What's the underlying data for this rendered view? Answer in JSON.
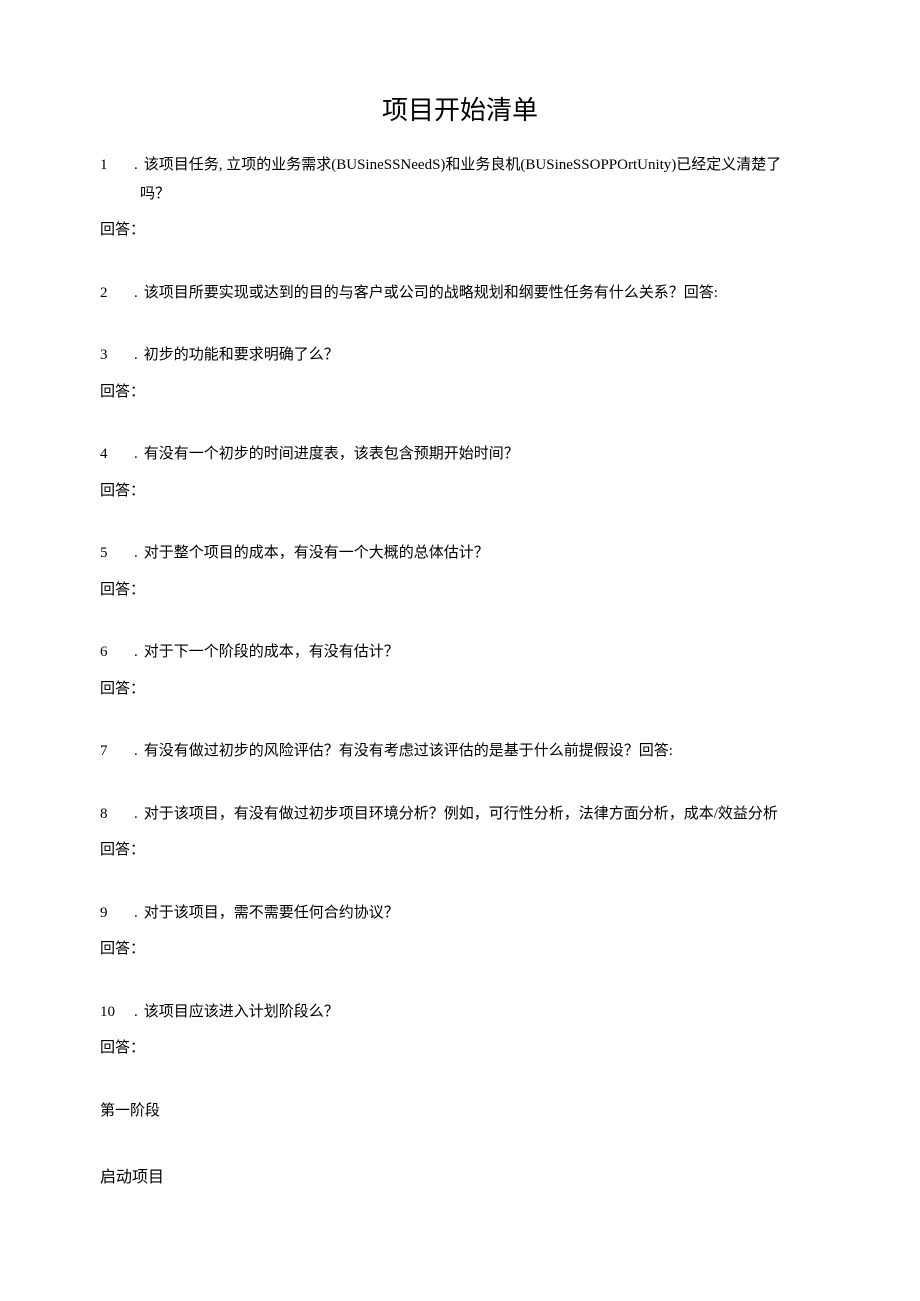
{
  "title": "项目开始清单",
  "answer_label": "回答：",
  "answer_label_alt": "回答:",
  "questions": [
    {
      "number": "1",
      "dot": ".",
      "text": "该项目任务, 立项的业务需求(BUSineSSNeedS)和业务良机(BUSineSSOPPOrtUnity)已经定义清楚了",
      "continuation": "吗？",
      "has_answer": true,
      "inline_answer": false
    },
    {
      "number": "2",
      "dot": ".",
      "text": "该项目所要实现或达到的目的与客户或公司的战略规划和纲要性任务有什么关系？",
      "continuation": null,
      "has_answer": true,
      "inline_answer": true
    },
    {
      "number": "3",
      "dot": ".",
      "text": "初步的功能和要求明确了么？",
      "continuation": null,
      "has_answer": true,
      "inline_answer": false
    },
    {
      "number": "4",
      "dot": ".",
      "text": "有没有一个初步的时间进度表，该表包含预期开始时间？",
      "continuation": null,
      "has_answer": true,
      "inline_answer": false
    },
    {
      "number": "5",
      "dot": ".",
      "text": "对于整个项目的成本，有没有一个大概的总体估计？",
      "continuation": null,
      "has_answer": true,
      "inline_answer": false
    },
    {
      "number": "6",
      "dot": ".",
      "text": "对于下一个阶段的成本，有没有估计？",
      "continuation": null,
      "has_answer": true,
      "inline_answer": false
    },
    {
      "number": "7",
      "dot": ".",
      "text": "有没有做过初步的风险评估？有没有考虑过该评估的是基于什么前提假设？",
      "continuation": null,
      "has_answer": true,
      "inline_answer": true
    },
    {
      "number": "8",
      "dot": ".",
      "text": "对于该项目，有没有做过初步项目环境分析？例如，可行性分析，法律方面分析，成本/效益分析",
      "continuation": null,
      "has_answer": true,
      "inline_answer": false
    },
    {
      "number": "9",
      "dot": ".",
      "text": "对于该项目，需不需要任何合约协议？",
      "continuation": null,
      "has_answer": true,
      "inline_answer": false
    },
    {
      "number": "10",
      "dot": ".",
      "text": "该项目应该进入计划阶段么？",
      "continuation": null,
      "has_answer": true,
      "inline_answer": false
    }
  ],
  "phase": "第一阶段",
  "startup": "启动项目"
}
